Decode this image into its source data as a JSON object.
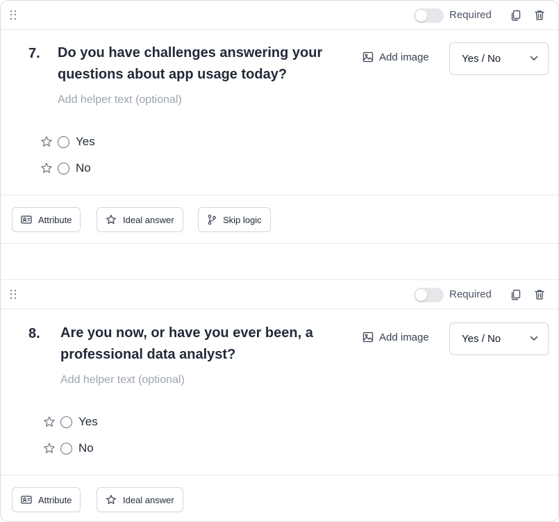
{
  "questions": [
    {
      "number": "7.",
      "title": "Do you have challenges answering your questions about app usage today?",
      "helper_placeholder": "Add helper text (optional)",
      "add_image_label": "Add image",
      "type_select": "Yes / No",
      "options": [
        "Yes",
        "No"
      ],
      "required_label": "Required",
      "required_on": false,
      "footer_buttons": {
        "attribute": "Attribute",
        "ideal_answer": "Ideal answer",
        "skip_logic": "Skip logic"
      }
    },
    {
      "number": "8.",
      "title": "Are you now, or have you ever been, a professional data analyst?",
      "helper_placeholder": "Add helper text (optional)",
      "add_image_label": "Add image",
      "type_select": "Yes / No",
      "options": [
        "Yes",
        "No"
      ],
      "required_label": "Required",
      "required_on": false,
      "footer_buttons": {
        "attribute": "Attribute",
        "ideal_answer": "Ideal answer"
      }
    }
  ],
  "icons": {
    "drag": "drag-handle-icon",
    "copy": "copy-icon",
    "trash": "trash-icon",
    "image": "image-icon",
    "chevron": "chevron-down-icon",
    "star": "star-icon",
    "attribute": "id-card-icon",
    "skip": "git-branch-icon"
  },
  "colors": {
    "text": "#1f2937",
    "muted": "#9ca3af",
    "border": "#d1d5db",
    "toggle_off": "#e5e7eb"
  }
}
